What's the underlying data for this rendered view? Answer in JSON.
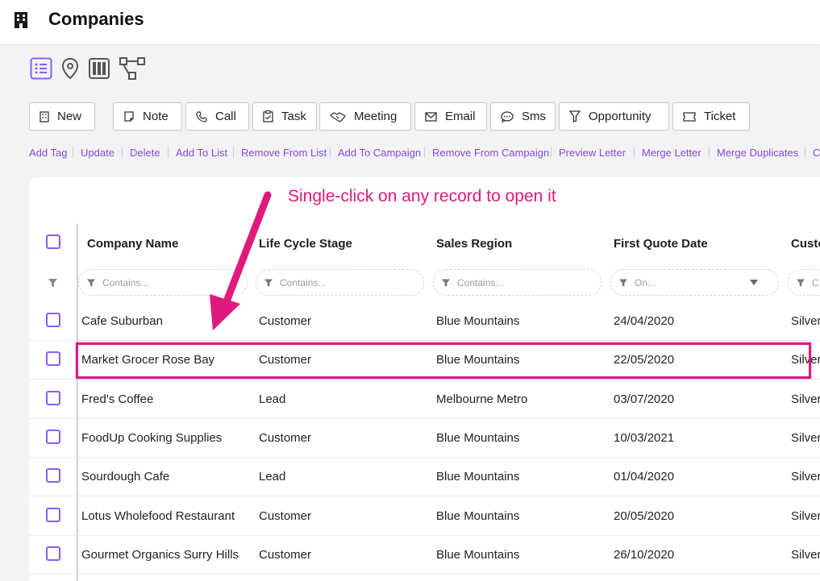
{
  "header": {
    "title": "Companies",
    "icon": "building-icon"
  },
  "view_switch": [
    {
      "name": "list-view-icon",
      "active": true
    },
    {
      "name": "map-view-icon",
      "active": false
    },
    {
      "name": "board-view-icon",
      "active": false
    },
    {
      "name": "hierarchy-view-icon",
      "active": false
    }
  ],
  "toolbar": {
    "new": "New",
    "note": "Note",
    "call": "Call",
    "task": "Task",
    "meeting": "Meeting",
    "email": "Email",
    "sms": "Sms",
    "opportunity": "Opportunity",
    "ticket": "Ticket"
  },
  "actions": [
    "Add Tag",
    "Update",
    "Delete",
    "Add To List",
    "Remove From List",
    "Add To Campaign",
    "Remove From Campaign",
    "Preview Letter",
    "Merge Letter",
    "Merge Duplicates",
    "C"
  ],
  "annotation": "Single-click on any record to open it",
  "table": {
    "columns": [
      "Company Name",
      "Life Cycle Stage",
      "Sales Region",
      "First Quote Date",
      "Custo"
    ],
    "filters": [
      "Contains...",
      "Contains...",
      "Contains...",
      "On...",
      "C"
    ],
    "rows": [
      {
        "company": "Cafe Suburban",
        "stage": "Customer",
        "region": "Blue Mountains",
        "date": "24/04/2020",
        "tier": "Silver"
      },
      {
        "company": "Market Grocer Rose Bay",
        "stage": "Customer",
        "region": "Blue Mountains",
        "date": "22/05/2020",
        "tier": "Silver"
      },
      {
        "company": "Fred's Coffee",
        "stage": "Lead",
        "region": "Melbourne Metro",
        "date": "03/07/2020",
        "tier": "Silver"
      },
      {
        "company": "FoodUp Cooking Supplies",
        "stage": "Customer",
        "region": "Blue Mountains",
        "date": "10/03/2021",
        "tier": "Silver"
      },
      {
        "company": "Sourdough Cafe",
        "stage": "Lead",
        "region": "Blue Mountains",
        "date": "01/04/2020",
        "tier": "Silver"
      },
      {
        "company": "Lotus Wholefood Restaurant",
        "stage": "Customer",
        "region": "Blue Mountains",
        "date": "20/05/2020",
        "tier": "Silver"
      },
      {
        "company": "Gourmet Organics Surry Hills",
        "stage": "Customer",
        "region": "Blue Mountains",
        "date": "26/10/2020",
        "tier": "Silver"
      }
    ]
  },
  "colors": {
    "accent": "#8b5cf6",
    "link": "#7d4cdb",
    "annotation": "#e0197d"
  }
}
